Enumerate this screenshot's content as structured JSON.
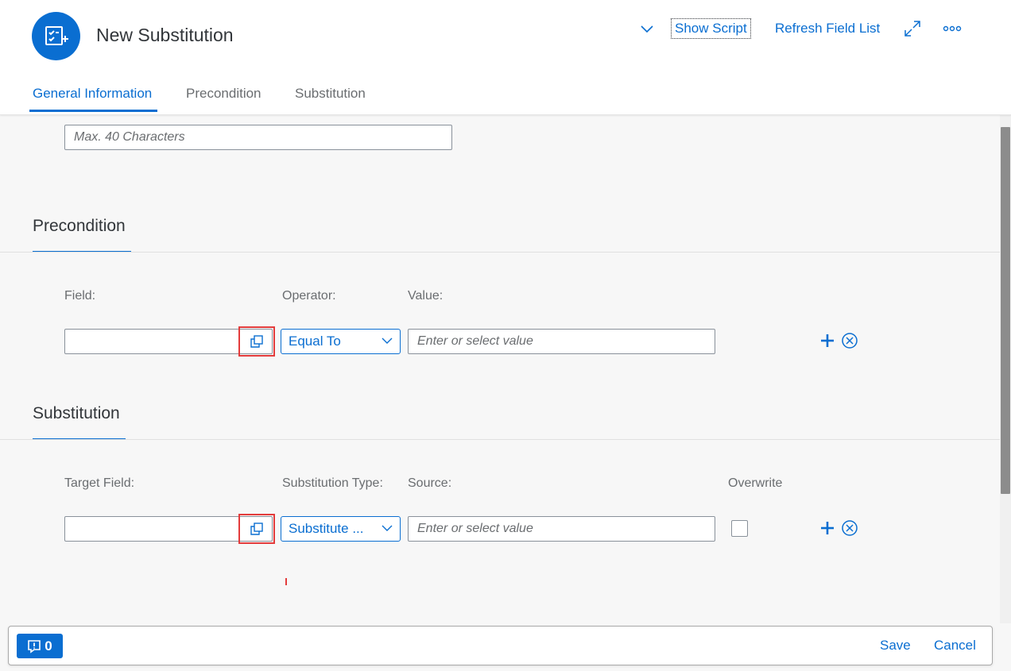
{
  "header": {
    "title": "New Substitution",
    "show_script": "Show Script",
    "refresh_field_list": "Refresh Field List",
    "icons": [
      "form-add-icon",
      "chevron-down-icon",
      "fullscreen-icon",
      "overflow-icon"
    ]
  },
  "tabs": [
    {
      "label": "General Information",
      "active": true
    },
    {
      "label": "Precondition",
      "active": false
    },
    {
      "label": "Substitution",
      "active": false
    }
  ],
  "general": {
    "description_placeholder": "Max. 40 Characters"
  },
  "precondition": {
    "title": "Precondition",
    "labels": {
      "field": "Field:",
      "operator": "Operator:",
      "value": "Value:"
    },
    "field_value": "",
    "operator_value": "Equal To",
    "value_placeholder": "Enter or select value"
  },
  "substitution": {
    "title": "Substitution",
    "labels": {
      "target_field": "Target Field:",
      "substitution_type": "Substitution Type:",
      "source": "Source:",
      "overwrite": "Overwrite"
    },
    "target_field_value": "",
    "substitution_type_value": "Substitute ...",
    "source_placeholder": "Enter or select value",
    "overwrite_checked": false
  },
  "footer": {
    "message_count": "0",
    "save": "Save",
    "cancel": "Cancel"
  },
  "colors": {
    "brand": "#0a6ed1",
    "highlight": "#e33c3c"
  }
}
